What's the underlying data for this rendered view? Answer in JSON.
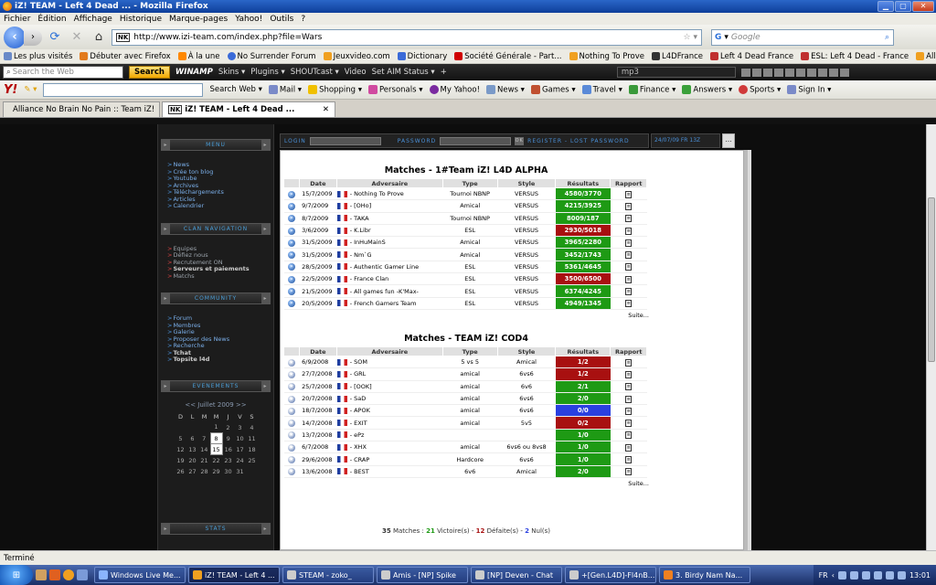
{
  "window": {
    "title": "iZ! TEAM - Left 4 Dead ... - Mozilla Firefox"
  },
  "menu": [
    "Fichier",
    "Édition",
    "Affichage",
    "Historique",
    "Marque-pages",
    "Yahoo!",
    "Outils",
    "?"
  ],
  "nav": {
    "url": "http://www.izi-team.com/index.php?file=Wars",
    "search_placeholder": "Google"
  },
  "bookmarks": [
    "Les plus visités",
    "Débuter avec Firefox",
    "À la une",
    "No Surrender Forum",
    "Jeuxvideo.com",
    "Dictionary",
    "Société Générale - Part...",
    "Nothing To Prove",
    "L4DFrance",
    "Left 4 Dead France",
    "ESL: Left 4 Dead - France",
    "Alliance No Brain No P..."
  ],
  "winamp": {
    "search_placeholder": "Search the Web",
    "search_button": "Search",
    "brand": "WINAMP",
    "items": [
      "Skins ▾",
      "Plugins ▾",
      "SHOUTcast ▾",
      "Video",
      "Set AIM Status ▾",
      "+"
    ],
    "player_field": "mp3"
  },
  "yahoo": {
    "logo": "Y!",
    "items": [
      "Search Web ▾",
      "Mail ▾",
      "Shopping ▾",
      "Personals ▾",
      "My Yahoo!",
      "News ▾",
      "Games ▾",
      "Travel ▾",
      "Finance ▾",
      "Answers ▾",
      "Sports ▾",
      "Sign In ▾"
    ]
  },
  "tabs": [
    {
      "label": "Alliance No Brain No Pain :: Team iZ!"
    },
    {
      "label": "iZ! TEAM - Left 4 Dead ..."
    }
  ],
  "site": {
    "topbar": {
      "login": "LOGIN",
      "password": "PASSWORD",
      "ok": "OK",
      "register": "REGISTER - LOST PASSWORD"
    },
    "date": "24/07/09 FR 13Z",
    "menu_header": "MENU",
    "menu_links": [
      "News",
      "Crée ton blog",
      "Youtube",
      "Archives",
      "Téléchargements",
      "Articles",
      "Calendrier"
    ],
    "clan_header": "CLAN NAVIGATION",
    "clan_links": [
      "Equipes",
      "Défiez nous",
      "Recrutement ON",
      "Serveurs et paiements",
      "Matchs"
    ],
    "community_header": "COMMUNITY",
    "community_links": [
      "Forum",
      "Membres",
      "Galerie",
      "Proposer des News",
      "Recherche",
      "Tchat",
      "Topsite l4d"
    ],
    "events_header": "EVENEMENTS",
    "calendar": {
      "title": "<< Juillet 2009 >>",
      "days": [
        "D",
        "L",
        "M",
        "M",
        "J",
        "V",
        "S"
      ],
      "weeks": [
        [
          "",
          "",
          "",
          "1",
          "2",
          "3",
          "4"
        ],
        [
          "5",
          "6",
          "7",
          "8",
          "9",
          "10",
          "11"
        ],
        [
          "12",
          "13",
          "14",
          "15",
          "16",
          "17",
          "18"
        ],
        [
          "19",
          "20",
          "21",
          "22",
          "23",
          "24",
          "25"
        ],
        [
          "26",
          "27",
          "28",
          "29",
          "30",
          "31",
          ""
        ]
      ],
      "selected": [
        "8",
        "15"
      ]
    },
    "stats_header": "STATS"
  },
  "matches_l4d": {
    "title": "Matches - 1#Team iZ! L4D ALPHA",
    "headers": [
      "Date",
      "Adversaire",
      "Type",
      "Style",
      "Résultats",
      "Rapport"
    ],
    "rows": [
      {
        "date": "15/7/2009",
        "opponent": "- Nothing To Prove",
        "type": "Tournoi NBNP",
        "style": "VERSUS",
        "result": "4580/3770",
        "status": "win"
      },
      {
        "date": "9/7/2009",
        "opponent": "- [OHo]",
        "type": "Amical",
        "style": "VERSUS",
        "result": "4215/3925",
        "status": "win"
      },
      {
        "date": "8/7/2009",
        "opponent": "- TAKA",
        "type": "Tournoi NBNP",
        "style": "VERSUS",
        "result": "8009/187",
        "status": "win"
      },
      {
        "date": "3/6/2009",
        "opponent": "- K.Libr",
        "type": "ESL",
        "style": "VERSUS",
        "result": "2930/5018",
        "status": "loss"
      },
      {
        "date": "31/5/2009",
        "opponent": "- InHuMainS",
        "type": "Amical",
        "style": "VERSUS",
        "result": "3965/2280",
        "status": "win"
      },
      {
        "date": "31/5/2009",
        "opponent": "- Nm`G",
        "type": "Amical",
        "style": "VERSUS",
        "result": "3452/1743",
        "status": "win"
      },
      {
        "date": "28/5/2009",
        "opponent": "- Authentic Gamer Line",
        "type": "ESL",
        "style": "VERSUS",
        "result": "5361/4645",
        "status": "win"
      },
      {
        "date": "22/5/2009",
        "opponent": "- France Clan",
        "type": "ESL",
        "style": "VERSUS",
        "result": "3500/6500",
        "status": "loss"
      },
      {
        "date": "21/5/2009",
        "opponent": "- All games fun -K'Max-",
        "type": "ESL",
        "style": "VERSUS",
        "result": "6374/4245",
        "status": "win"
      },
      {
        "date": "20/5/2009",
        "opponent": "- French Gamers Team",
        "type": "ESL",
        "style": "VERSUS",
        "result": "4949/1345",
        "status": "win"
      }
    ],
    "more": "Suite..."
  },
  "matches_cod4": {
    "title": "Matches - TEAM iZ! COD4",
    "headers": [
      "Date",
      "Adversaire",
      "Type",
      "Style",
      "Résultats",
      "Rapport"
    ],
    "rows": [
      {
        "date": "6/9/2008",
        "opponent": "- SOM",
        "type": "5 vs 5",
        "style": "Amical",
        "result": "1/2",
        "status": "loss"
      },
      {
        "date": "27/7/2008",
        "opponent": "- GRL",
        "type": "amical",
        "style": "6vs6",
        "result": "1/2",
        "status": "loss"
      },
      {
        "date": "25/7/2008",
        "opponent": "- [OOK]",
        "type": "amical",
        "style": "6v6",
        "result": "2/1",
        "status": "win"
      },
      {
        "date": "20/7/2008",
        "opponent": "- SaD",
        "type": "amical",
        "style": "6vs6",
        "result": "2/0",
        "status": "win"
      },
      {
        "date": "18/7/2008",
        "opponent": "- APOK",
        "type": "amical",
        "style": "6vs6",
        "result": "0/0",
        "status": "draw"
      },
      {
        "date": "14/7/2008",
        "opponent": "- EXIT",
        "type": "amical",
        "style": "5v5",
        "result": "0/2",
        "status": "loss"
      },
      {
        "date": "13/7/2008",
        "opponent": "- ePz",
        "type": "",
        "style": "",
        "result": "1/0",
        "status": "win"
      },
      {
        "date": "6/7/2008",
        "opponent": "- XHX",
        "type": "amical",
        "style": "6vs6 ou 8vs8",
        "result": "1/0",
        "status": "win"
      },
      {
        "date": "29/6/2008",
        "opponent": "- CRAP",
        "type": "Hardcore",
        "style": "6vs6",
        "result": "1/0",
        "status": "win"
      },
      {
        "date": "13/6/2008",
        "opponent": "- BEST",
        "type": "6v6",
        "style": "Amical",
        "result": "2/0",
        "status": "win"
      }
    ],
    "more": "Suite..."
  },
  "summary": {
    "total": "35",
    "total_label": "Matches :",
    "wins": "21",
    "wins_label": "Victoire(s) -",
    "losses": "12",
    "losses_label": "Défaite(s) -",
    "draws": "2",
    "draws_label": "Nul(s)"
  },
  "statusbar": "Terminé",
  "taskbar": {
    "items": [
      "Windows Live Me...",
      "iZ! TEAM - Left 4 ...",
      "STEAM - zoko_",
      "Amis - [NP] Spike",
      "[NP] Deven - Chat",
      "+[Gen.L4D]-Fl4nB...",
      "3. Birdy Nam Na..."
    ],
    "lang": "FR",
    "clock": "13:01"
  },
  "colors": {
    "win": "#1e9a14",
    "loss": "#a81010",
    "draw": "#2a40e0"
  }
}
